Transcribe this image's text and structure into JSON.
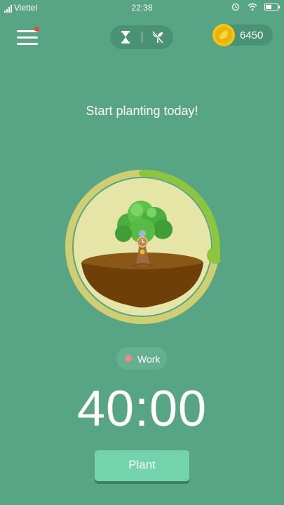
{
  "status_bar": {
    "carrier": "Viettel",
    "time": "22:38"
  },
  "header": {
    "menu_icon": "menu-icon",
    "notification_color": "#e6473c",
    "mode_icons": [
      "hourglass-icon",
      "no-plant-icon"
    ],
    "coins": "6450"
  },
  "main": {
    "headline": "Start planting today!",
    "tag": {
      "label": "Work",
      "color": "#e98d82"
    },
    "timer": "40:00",
    "plant_button": "Plant",
    "progress": 0.25
  },
  "colors": {
    "background": "#57a584",
    "progress_arc": "#8cc63f",
    "ring": "#cfcf72",
    "ground": "#7a4a10",
    "button": "#73d3ad"
  }
}
